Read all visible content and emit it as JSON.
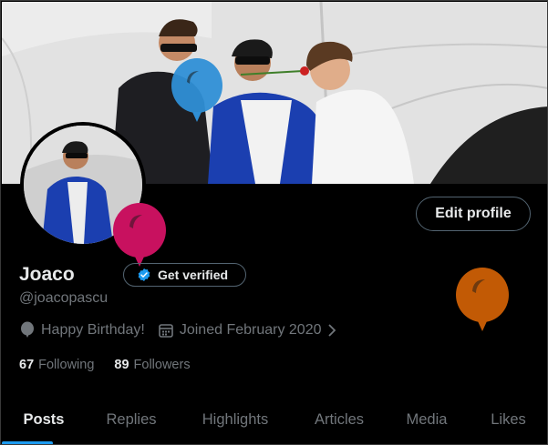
{
  "profile": {
    "name": "Joaco",
    "handle": "@joacopascu",
    "get_verified_label": "Get verified",
    "edit_profile_label": "Edit profile",
    "birthday": "Happy Birthday!",
    "joined": "Joined February 2020"
  },
  "stats": {
    "following_count": "67",
    "following_label": "Following",
    "followers_count": "89",
    "followers_label": "Followers"
  },
  "tabs": [
    {
      "label": "Posts"
    },
    {
      "label": "Replies"
    },
    {
      "label": "Highlights"
    },
    {
      "label": "Articles"
    },
    {
      "label": "Media"
    },
    {
      "label": "Likes"
    }
  ],
  "colors": {
    "accent": "#1d9bf0",
    "balloon_blue": "#2f8fd6",
    "balloon_pink": "#c8115f",
    "balloon_orange": "#c25a05"
  },
  "icons": {
    "balloon": "balloon-icon",
    "calendar": "calendar-icon",
    "verified": "verified-badge-icon",
    "chevron": "chevron-right-icon"
  }
}
